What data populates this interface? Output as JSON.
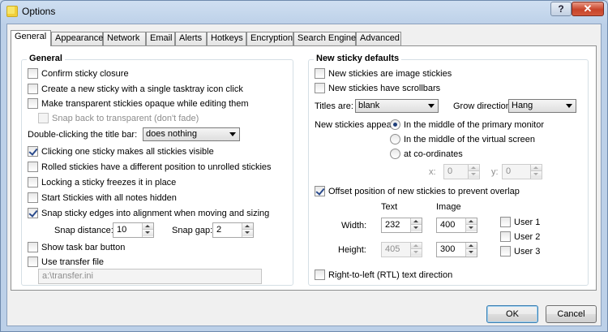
{
  "window": {
    "title": "Options",
    "help_label": "?",
    "close_label": "✕"
  },
  "tabs": [
    "General",
    "Appearance",
    "Network",
    "Email",
    "Alerts",
    "Hotkeys",
    "Encryption",
    "Search Engines",
    "Advanced"
  ],
  "general": {
    "title": "General",
    "confirm_sticky_closure": "Confirm sticky closure",
    "single_tasktray_click": "Create a new sticky with a single tasktray icon click",
    "make_opaque": "Make transparent stickies opaque while editing them",
    "snap_back": "Snap back to transparent (don't fade)",
    "double_click_label": "Double-clicking the title bar:",
    "double_click_value": "does nothing",
    "clicking_one_visible": "Clicking one sticky makes all stickies visible",
    "rolled_different_position": "Rolled stickies have a different position to unrolled stickies",
    "locking_freezes": "Locking a sticky freezes it in place",
    "start_hidden": "Start Stickies with all notes hidden",
    "snap_edges": "Snap sticky edges into alignment when moving and sizing",
    "snap_distance_label": "Snap distance:",
    "snap_distance_value": "10",
    "snap_gap_label": "Snap gap:",
    "snap_gap_value": "2",
    "show_taskbar_button": "Show task bar button",
    "use_transfer_file": "Use transfer file",
    "transfer_file_path": "a:\\transfer.ini"
  },
  "defaults": {
    "title": "New sticky defaults",
    "image_stickies": "New stickies are image stickies",
    "have_scrollbars": "New stickies have scrollbars",
    "titles_label": "Titles are:",
    "titles_value": "blank",
    "grow_label": "Grow direction:",
    "grow_value": "Hang",
    "appear_label": "New stickies appear:",
    "appear_primary": "In the middle of the primary monitor",
    "appear_virtual": "In the middle of the virtual screen",
    "appear_coords": "at co-ordinates",
    "x_label": "x:",
    "x_value": "0",
    "y_label": "y:",
    "y_value": "0",
    "offset_position": "Offset position of new stickies to prevent overlap",
    "text_header": "Text",
    "image_header": "Image",
    "width_label": "Width:",
    "width_text": "232",
    "width_image": "400",
    "height_label": "Height:",
    "height_text": "405",
    "height_image": "300",
    "user1": "User 1",
    "user2": "User 2",
    "user3": "User 3",
    "rtl": "Right-to-left (RTL) text direction"
  },
  "footer": {
    "ok_label": "OK",
    "cancel_label": "Cancel"
  }
}
